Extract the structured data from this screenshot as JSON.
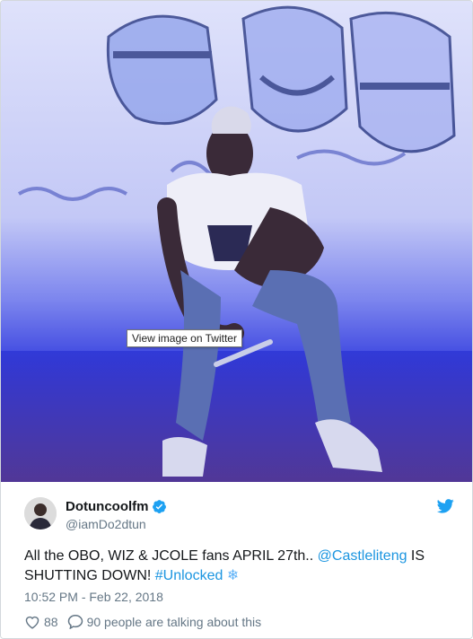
{
  "media": {
    "tooltip": "View image on Twitter"
  },
  "tweet": {
    "display_name": "Dotuncoolfm",
    "handle": "@iamDo2dtun",
    "text_prefix": "All the OBO, WIZ & JCOLE fans APRIL 27th.. ",
    "mention": "@Castleliteng",
    "text_middle": " IS SHUTTING DOWN! ",
    "hashtag": "#Unlocked",
    "emoji": "❄",
    "timestamp": "10:52 PM - Feb 22, 2018",
    "likes": "88",
    "talking": "90 people are talking about this"
  },
  "colors": {
    "link": "#1b95e0",
    "twitter_blue": "#1da1f2",
    "muted": "#657786",
    "text": "#14171a"
  },
  "icons": [
    "twitter-bird-icon",
    "verified-badge-icon",
    "heart-icon",
    "comment-bubble-icon",
    "snowflake-icon"
  ]
}
